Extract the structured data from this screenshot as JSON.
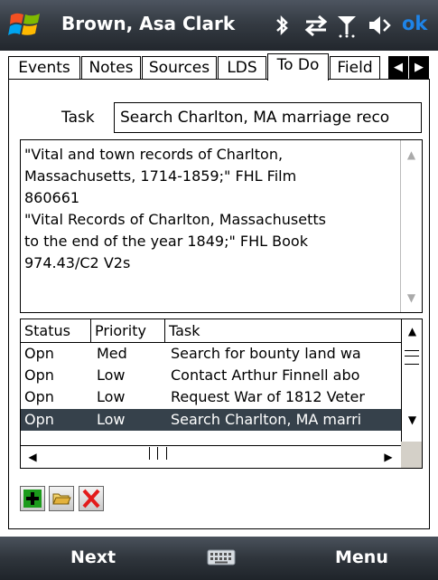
{
  "titlebar": {
    "title": "Brown, Asa Clark",
    "status_icons": [
      "windows-start-icon",
      "bluetooth-icon",
      "data-connection-icon",
      "signal-icon",
      "volume-icon"
    ],
    "ok_label": "ok"
  },
  "tabs": [
    {
      "label": "Events",
      "active": false
    },
    {
      "label": "Notes",
      "active": false
    },
    {
      "label": "Sources",
      "active": false
    },
    {
      "label": "LDS",
      "active": false
    },
    {
      "label": "To Do",
      "active": true
    },
    {
      "label": "Field",
      "active": false
    }
  ],
  "form": {
    "task_label": "Task",
    "task_value": "Search Charlton, MA marriage reco",
    "notes": "\"Vital and town records of Charlton,\nMassachusetts, 1714-1859;\" FHL Film\n860661\n\"Vital Records of Charlton, Massachusetts\nto the end of the year 1849;\" FHL Book\n974.43/C2 V2s"
  },
  "table": {
    "columns": [
      "Status",
      "Priority",
      "Task"
    ],
    "rows": [
      {
        "status": "Opn",
        "priority": "Med",
        "task": "Search for bounty land wa",
        "selected": false
      },
      {
        "status": "Opn",
        "priority": "Low",
        "task": "Contact Arthur Finnell abo",
        "selected": false
      },
      {
        "status": "Opn",
        "priority": "Low",
        "task": "Request War of 1812 Veter",
        "selected": false
      },
      {
        "status": "Opn",
        "priority": "Low",
        "task": "Search Charlton, MA marri",
        "selected": true
      }
    ]
  },
  "actions": [
    {
      "name": "add-icon",
      "color": "#1b9b1b"
    },
    {
      "name": "open-folder-icon",
      "color": "#d4a017"
    },
    {
      "name": "delete-icon",
      "color": "#e31b1b"
    }
  ],
  "bottombar": {
    "left_soft_key": "Next",
    "right_soft_key": "Menu",
    "keyboard_icon": "keyboard-icon"
  },
  "colors": {
    "titlebar": "#353b43",
    "selection": "#36414b",
    "ok": "#1e84e8"
  }
}
